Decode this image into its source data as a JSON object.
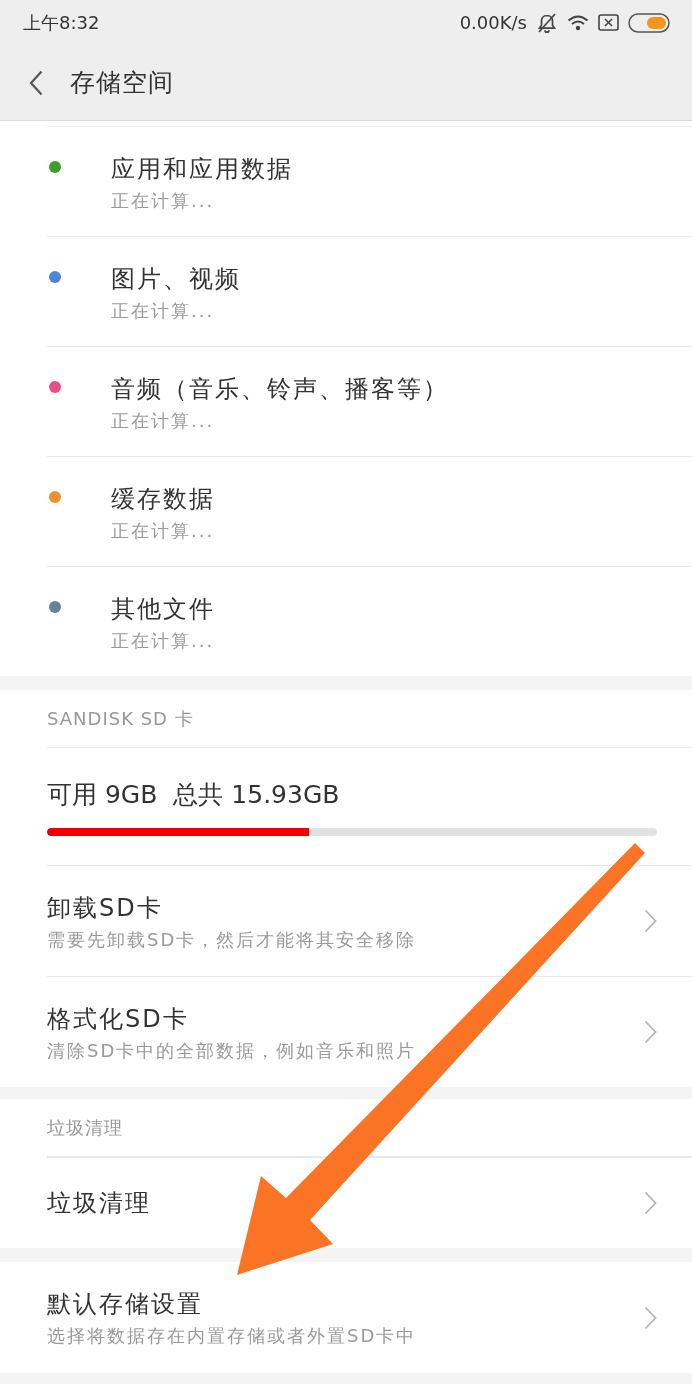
{
  "status_bar": {
    "time": "上午8:32",
    "network_speed": "0.00K/s"
  },
  "header": {
    "title": "存储空间"
  },
  "categories": [
    {
      "name": "应用和应用数据",
      "status": "正在计算...",
      "color": "#3c9f2c"
    },
    {
      "name": "图片、视频",
      "status": "正在计算...",
      "color": "#4a86dc"
    },
    {
      "name": "音频（音乐、铃声、播客等）",
      "status": "正在计算...",
      "color": "#ec4d87"
    },
    {
      "name": "缓存数据",
      "status": "正在计算...",
      "color": "#f0902c"
    },
    {
      "name": "其他文件",
      "status": "正在计算...",
      "color": "#6b8199"
    }
  ],
  "sd_card": {
    "section_title": "SANDISK SD 卡",
    "available": "可用 9GB",
    "total": "总共 15.93GB",
    "level": 0.43,
    "actions": [
      {
        "title": "卸载SD卡",
        "subtitle": "需要先卸载SD卡，然后才能将其安全移除"
      },
      {
        "title": "格式化SD卡",
        "subtitle": "清除SD卡中的全部数据，例如音乐和照片"
      }
    ]
  },
  "cleanup": {
    "section_title": "垃圾清理",
    "actions": [
      {
        "title": "垃圾清理"
      }
    ]
  },
  "storage_settings": {
    "actions": [
      {
        "title": "默认存储设置",
        "subtitle": "选择将数据存在内置存储或者外置SD卡中"
      }
    ]
  }
}
